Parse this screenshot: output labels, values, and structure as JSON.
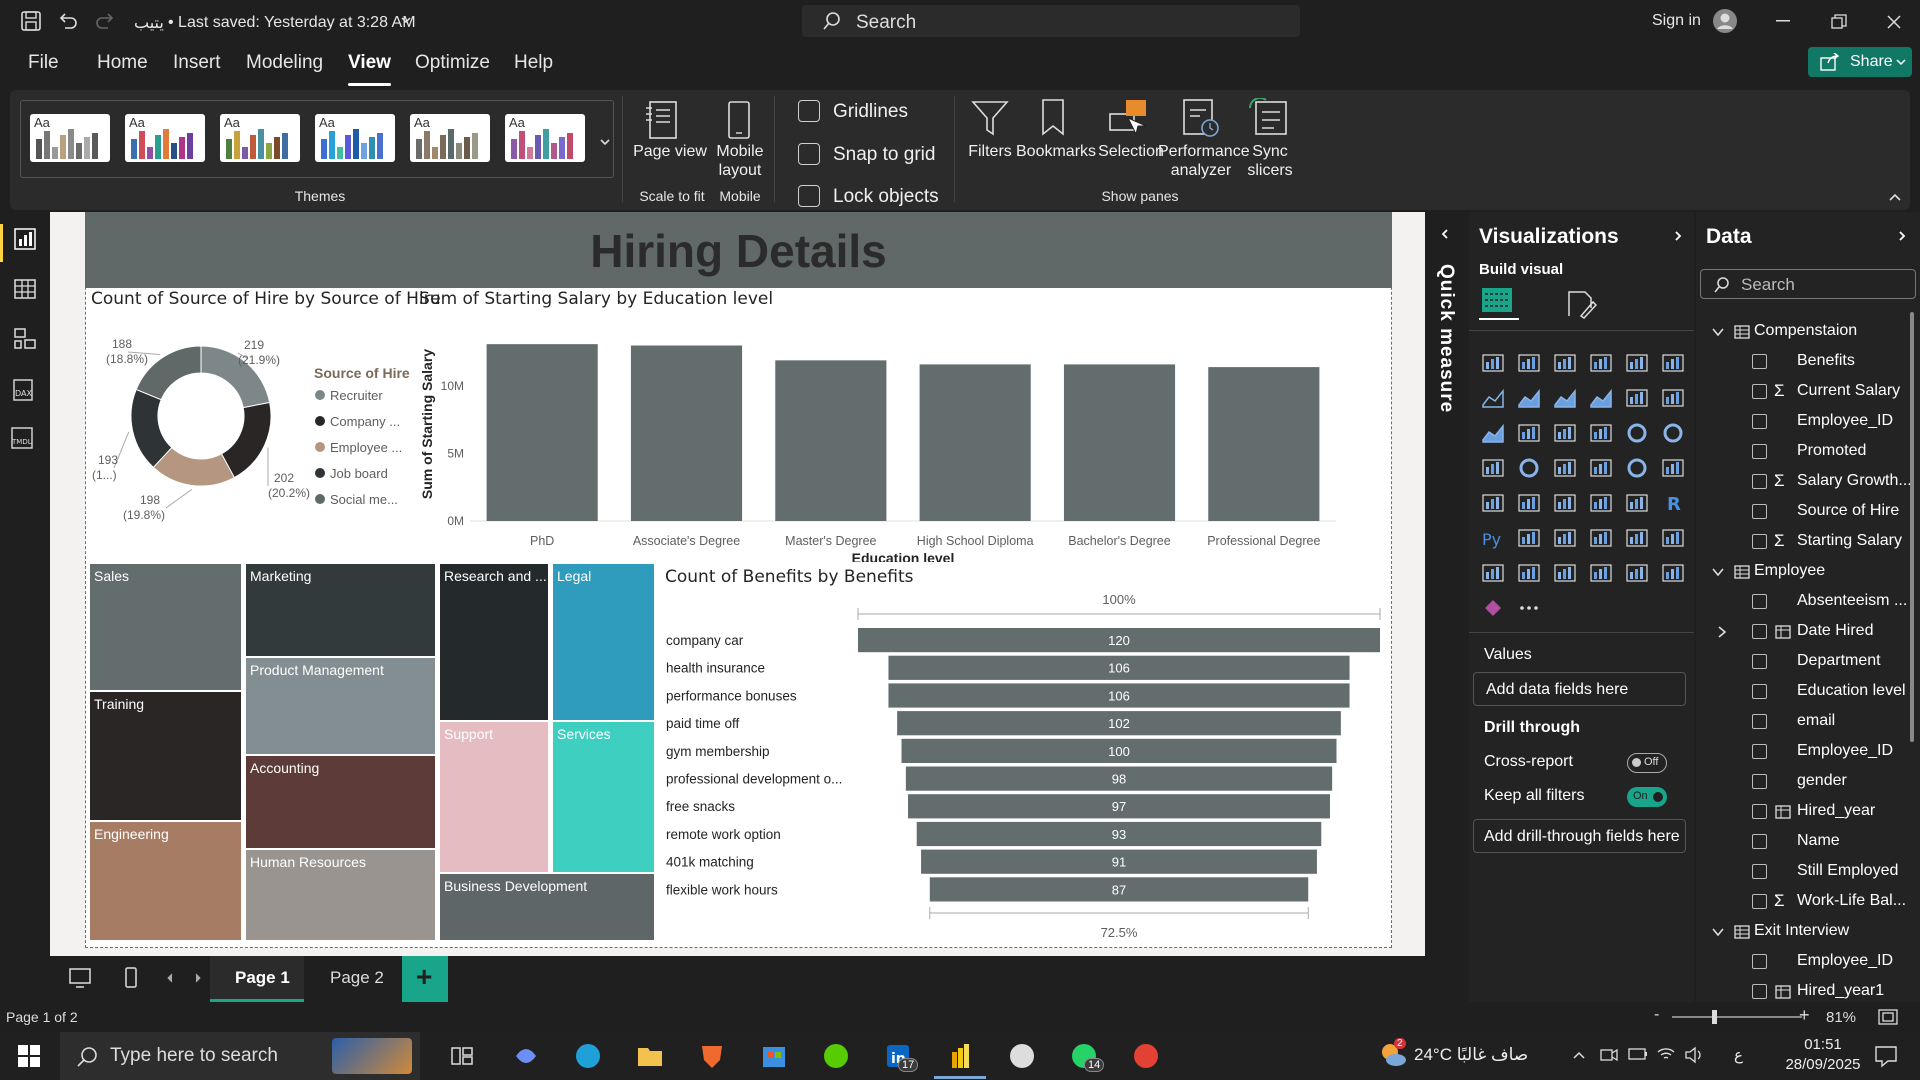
{
  "titlebar": {
    "file_title": "يتيب",
    "save_status": "• Last saved: Yesterday at 3:28 AM",
    "search_placeholder": "Search",
    "sign_in": "Sign in"
  },
  "ribbon_tabs": [
    "File",
    "Home",
    "Insert",
    "Modeling",
    "View",
    "Optimize",
    "Help"
  ],
  "active_tab": "View",
  "share_label": "Share",
  "ribbon": {
    "themes_label": "Themes",
    "theme_thumb_text": "Aa",
    "page_view": "Page view",
    "scale_to_fit": "Scale to fit",
    "mobile_layout": "Mobile layout",
    "mobile": "Mobile",
    "gridlines": "Gridlines",
    "snap_to_grid": "Snap to grid",
    "lock_objects": "Lock objects",
    "filters": "Filters",
    "bookmarks": "Bookmarks",
    "selection": "Selection",
    "performance_analyzer": "Performance analyzer",
    "sync_slicers": "Sync slicers",
    "show_panes": "Show panes"
  },
  "report": {
    "title": "Hiring Details",
    "donut": {
      "title": "Count of Source of Hire by Source of Hire",
      "legend_title": "Source of Hire",
      "legend": [
        "Recruiter",
        "Company ...",
        "Employee ...",
        "Job board",
        "Social me..."
      ],
      "colors": [
        "#7d878a",
        "#2b2626",
        "#b59680",
        "#2e3436",
        "#616868"
      ],
      "labels": [
        {
          "v": "219",
          "p": "(21.9%)"
        },
        {
          "v": "202",
          "p": "(20.2%)"
        },
        {
          "v": "198",
          "p": "(19.8%)"
        },
        {
          "v": "193",
          "p": "(1...)"
        },
        {
          "v": "188",
          "p": "(18.8%)"
        }
      ]
    },
    "bar": {
      "title": "Sum of Starting Salary by Education level",
      "xlabel": "Education level",
      "ylabel": "Sum of Starting Salary",
      "ticks": [
        "0M",
        "5M",
        "10M"
      ]
    },
    "treemap": {
      "tiles": [
        "Sales",
        "Training",
        "Engineering",
        "Marketing",
        "Product Management",
        "Accounting",
        "Human Resources",
        "Research and ...",
        "Support",
        "Legal",
        "Services",
        "Business Development"
      ]
    },
    "funnel": {
      "title": "Count of Benefits by Benefits",
      "top_pct": "100%",
      "bottom_pct": "72.5%"
    }
  },
  "chart_data": [
    {
      "type": "pie",
      "title": "Count of Source of Hire by Source of Hire",
      "categories": [
        "Recruiter",
        "Company ...",
        "Employee ...",
        "Job board",
        "Social me..."
      ],
      "values": [
        219,
        202,
        198,
        193,
        188
      ]
    },
    {
      "type": "bar",
      "title": "Sum of Starting Salary by Education level",
      "xlabel": "Education level",
      "ylabel": "Sum of Starting Salary",
      "categories": [
        "PhD",
        "Associate's Degree",
        "Master's Degree",
        "High School Diploma",
        "Bachelor's Degree",
        "Professional Degree"
      ],
      "values": [
        13.1,
        13.0,
        11.9,
        11.6,
        11.6,
        11.4
      ],
      "unit": "M",
      "ylim": [
        0,
        14
      ]
    },
    {
      "type": "bar",
      "title": "Count of Benefits by Benefits",
      "categories": [
        "company car",
        "health insurance",
        "performance bonuses",
        "paid time off",
        "gym membership",
        "professional development o...",
        "free snacks",
        "remote work option",
        "401k matching",
        "flexible work hours"
      ],
      "values": [
        120,
        106,
        106,
        102,
        100,
        98,
        97,
        93,
        91,
        87
      ]
    }
  ],
  "pages": {
    "page1": "Page 1",
    "page2": "Page 2",
    "add": "+"
  },
  "status": {
    "page_of": "Page 1 of 2",
    "zoom": "81%"
  },
  "quick_measure": "Quick measure",
  "visualizations": {
    "title": "Visualizations",
    "build_visual": "Build visual",
    "values": "Values",
    "add_data": "Add data fields here",
    "drill_through": "Drill through",
    "cross_report": "Cross-report",
    "cross_state": "Off",
    "keep_filters": "Keep all filters",
    "keep_state": "On",
    "add_drill": "Add drill-through fields here"
  },
  "data_pane": {
    "title": "Data",
    "search_placeholder": "Search",
    "tables": [
      {
        "name": "Compenstaion",
        "fields": [
          {
            "n": "Benefits",
            "s": ""
          },
          {
            "n": "Current Salary",
            "s": "Σ"
          },
          {
            "n": "Employee_ID",
            "s": ""
          },
          {
            "n": "Promoted",
            "s": ""
          },
          {
            "n": "Salary Growth...",
            "s": "Σ"
          },
          {
            "n": "Source of Hire",
            "s": ""
          },
          {
            "n": "Starting Salary",
            "s": "Σ"
          }
        ]
      },
      {
        "name": "Employee",
        "fields": [
          {
            "n": "Absenteeism ...",
            "s": ""
          },
          {
            "n": "Date Hired",
            "s": "cal"
          },
          {
            "n": "Department",
            "s": ""
          },
          {
            "n": "Education level",
            "s": ""
          },
          {
            "n": "email",
            "s": ""
          },
          {
            "n": "Employee_ID",
            "s": ""
          },
          {
            "n": "gender",
            "s": ""
          },
          {
            "n": "Hired_year",
            "s": "tbl"
          },
          {
            "n": "Name",
            "s": ""
          },
          {
            "n": "Still Employed",
            "s": ""
          },
          {
            "n": "Work-Life Bal...",
            "s": "Σ"
          }
        ]
      },
      {
        "name": "Exit Interview",
        "fields": [
          {
            "n": "Employee_ID",
            "s": ""
          },
          {
            "n": "Hired_year1",
            "s": "tbl"
          }
        ]
      }
    ]
  },
  "taskbar": {
    "search_placeholder": "Type here to search",
    "weather": "24°C  صاف غالبًا",
    "time": "01:51",
    "date": "28/09/2025",
    "lang": "ع",
    "badge_linkedin": "17",
    "badge_whatsapp": "14",
    "badge_weather": "2"
  }
}
